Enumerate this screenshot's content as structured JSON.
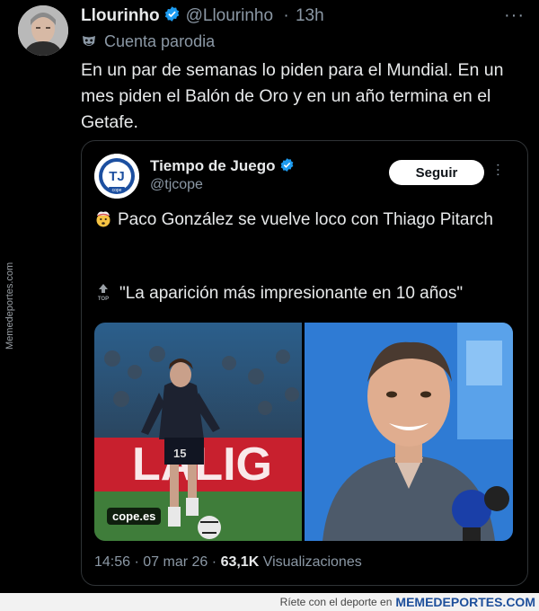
{
  "tweet": {
    "author_name": "Llourinho",
    "handle": "@Llourinho",
    "separator": "·",
    "time": "13h",
    "more": "···",
    "label": "Cuenta parodia",
    "text": "En un par de semanas lo piden para el Mundial. En un mes piden el Balón de Oro y en un año termina en el Getafe."
  },
  "quote": {
    "author_name": "Tiempo de Juego",
    "handle": "@tjcope",
    "follow_label": "Seguir",
    "logo_text": "TJ",
    "logo_subtext": "cope",
    "text_line1": "Paco González se vuelve loco con Thiago Pitarch",
    "text_line2": "\"La aparición más impresionante en 10 años\"",
    "media_badge": "cope.es",
    "media_jersey_number": "15",
    "media_banner_text": "LALIG",
    "time": "14:56",
    "date": "07 mar 26",
    "views_count": "63,1K",
    "views_label": "Visualizaciones"
  },
  "watermark": {
    "side": "Memedeportes.com",
    "footer_text": "Ríete con el deporte en",
    "footer_brand": "MEMEDEPORTES.COM"
  },
  "colors": {
    "background": "#000000",
    "text": "#e7e9ea",
    "muted": "#8b98a5",
    "verified": "#1d9bf0",
    "border": "#2f3336"
  }
}
